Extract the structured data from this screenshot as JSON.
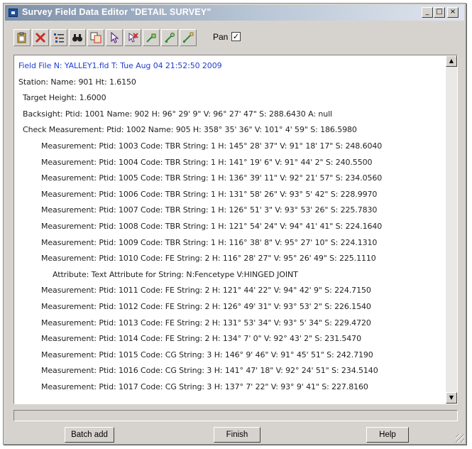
{
  "window": {
    "title": "Survey Field Data Editor \"DETAIL SURVEY\"",
    "controls": {
      "minimize": "_",
      "maximize": "□",
      "close": "×"
    }
  },
  "toolbar": {
    "buttons": [
      {
        "icon": "clipboard-icon"
      },
      {
        "icon": "delete-x-icon"
      },
      {
        "icon": "list-tree-icon"
      },
      {
        "icon": "binoculars-icon"
      },
      {
        "icon": "copy-pages-icon"
      },
      {
        "icon": "pointer-icon"
      },
      {
        "icon": "select-cancel-icon"
      },
      {
        "icon": "string-green-1-icon"
      },
      {
        "icon": "string-green-2-icon"
      },
      {
        "icon": "string-green-3-icon"
      }
    ],
    "pan_label": "Pan",
    "pan_checked": "✓"
  },
  "records": [
    {
      "indent": 0,
      "kind": "file",
      "text": "Field File N: YALLEY1.fld T: Tue Aug 04 21:52:50 2009"
    },
    {
      "indent": 0,
      "kind": "station",
      "text": "Station: Name: 901 Ht: 1.6150"
    },
    {
      "indent": 1,
      "kind": "target",
      "text": "Target Height: 1.6000"
    },
    {
      "indent": 1,
      "kind": "backsight",
      "text": "Backsight: Ptid: 1001 Name: 902 H: 96° 29' 9\" V: 96° 27' 47\" S: 288.6430 A: null"
    },
    {
      "indent": 1,
      "kind": "check",
      "text": "Check Measurement: Ptid: 1002 Name: 905 H: 358° 35' 36\" V: 101° 4' 59\" S: 186.5980"
    },
    {
      "indent": 2,
      "kind": "measurement",
      "text": "Measurement: Ptid: 1003 Code: TBR String: 1 H: 145° 28' 37\" V: 91° 18' 17\" S: 248.6040"
    },
    {
      "indent": 2,
      "kind": "measurement",
      "text": "Measurement: Ptid: 1004 Code: TBR String: 1 H: 141° 19' 6\" V: 91° 44' 2\" S: 240.5500"
    },
    {
      "indent": 2,
      "kind": "measurement",
      "text": "Measurement: Ptid: 1005 Code: TBR String: 1 H: 136° 39' 11\" V: 92° 21' 57\" S: 234.0560"
    },
    {
      "indent": 2,
      "kind": "measurement",
      "text": "Measurement: Ptid: 1006 Code: TBR String: 1 H: 131° 58' 26\" V: 93° 5' 42\" S: 228.9970"
    },
    {
      "indent": 2,
      "kind": "measurement",
      "text": "Measurement: Ptid: 1007 Code: TBR String: 1 H: 126° 51' 3\" V: 93° 53' 26\" S: 225.7830"
    },
    {
      "indent": 2,
      "kind": "measurement",
      "text": "Measurement: Ptid: 1008 Code: TBR String: 1 H: 121° 54' 24\" V: 94° 41' 41\" S: 224.1640"
    },
    {
      "indent": 2,
      "kind": "measurement",
      "text": "Measurement: Ptid: 1009 Code: TBR String: 1 H: 116° 38' 8\" V: 95° 27' 10\" S: 224.1310"
    },
    {
      "indent": 2,
      "kind": "measurement",
      "text": "Measurement: Ptid: 1010 Code: FE String: 2 H: 116° 28' 27\" V: 95° 26' 49\" S: 225.1110"
    },
    {
      "indent": 3,
      "kind": "attribute",
      "text": "Attribute: Text Attribute for String: N:Fencetype V:HINGED JOINT"
    },
    {
      "indent": 2,
      "kind": "measurement",
      "text": "Measurement: Ptid: 1011 Code: FE String: 2 H: 121° 44' 22\" V: 94° 42' 9\" S: 224.7150"
    },
    {
      "indent": 2,
      "kind": "measurement",
      "text": "Measurement: Ptid: 1012 Code: FE String: 2 H: 126° 49' 31\" V: 93° 53' 2\" S: 226.1540"
    },
    {
      "indent": 2,
      "kind": "measurement",
      "text": "Measurement: Ptid: 1013 Code: FE String: 2 H: 131° 53' 34\" V: 93° 5' 34\" S: 229.4720"
    },
    {
      "indent": 2,
      "kind": "measurement",
      "text": "Measurement: Ptid: 1014 Code: FE String: 2 H: 134° 7' 0\" V: 92° 43' 2\" S: 231.5470"
    },
    {
      "indent": 2,
      "kind": "measurement",
      "text": "Measurement: Ptid: 1015 Code: CG String: 3 H: 146° 9' 46\" V: 91° 45' 51\" S: 242.7190"
    },
    {
      "indent": 2,
      "kind": "measurement",
      "text": "Measurement: Ptid: 1016 Code: CG String: 3 H: 141° 47' 18\" V: 92° 24' 51\" S: 234.5140"
    },
    {
      "indent": 2,
      "kind": "measurement",
      "text": "Measurement: Ptid: 1017 Code: CG String: 3 H: 137° 7' 22\" V: 93° 9' 41\" S: 227.8160"
    }
  ],
  "scrollbar": {
    "up": "▲",
    "down": "▼"
  },
  "buttons": {
    "batch_add": "Batch add",
    "finish": "Finish",
    "help": "Help"
  },
  "colors": {
    "file_line": "#1f3fd0",
    "window_bg": "#d6d3ce"
  }
}
